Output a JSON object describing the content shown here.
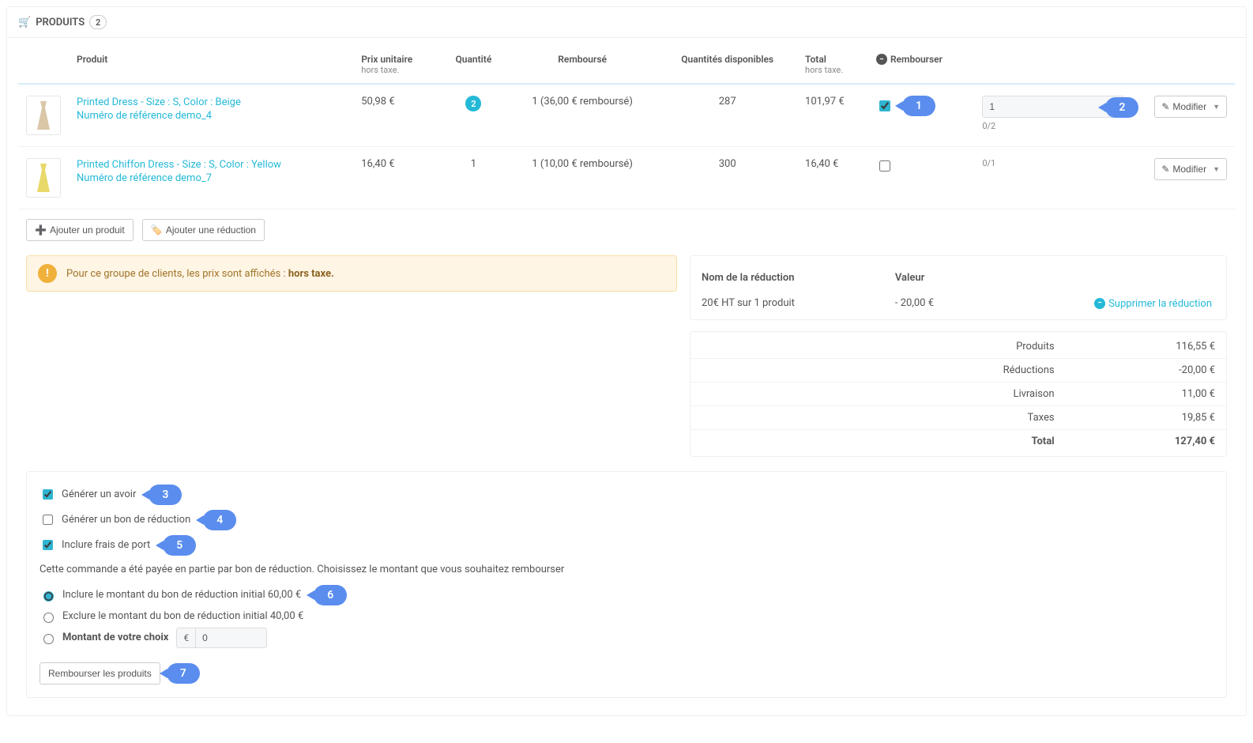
{
  "header": {
    "title": "PRODUITS",
    "count": "2"
  },
  "columns": {
    "product": "Produit",
    "unit_price": "Prix unitaire",
    "tax_note": "hors taxe.",
    "quantity": "Quantité",
    "refunded": "Remboursé",
    "avail_qty": "Quantités disponibles",
    "total": "Total",
    "refund": "Rembourser"
  },
  "products": [
    {
      "name": "Printed Dress - Size : S, Color : Beige",
      "ref": "Numéro de référence demo_4",
      "unit_price": "50,98 €",
      "quantity": "2",
      "qty_badge": true,
      "refunded": "1 (36,00 € remboursé)",
      "available": "287",
      "total": "101,97 €",
      "checkbox_checked": true,
      "callout_check": "1",
      "qty_input_value": "1",
      "callout_qty": "2",
      "qty_limit": "0/2",
      "edit_label": "Modifier"
    },
    {
      "name": "Printed Chiffon Dress - Size : S, Color : Yellow",
      "ref": "Numéro de référence demo_7",
      "unit_price": "16,40 €",
      "quantity": "1",
      "qty_badge": false,
      "refunded": "1 (10,00 € remboursé)",
      "available": "300",
      "total": "16,40 €",
      "checkbox_checked": false,
      "qty_limit": "0/1",
      "edit_label": "Modifier"
    }
  ],
  "actions": {
    "add_product": "Ajouter un produit",
    "add_discount": "Ajouter une réduction"
  },
  "notice": {
    "text_prefix": "Pour ce groupe de clients, les prix sont affichés : ",
    "text_bold": "hors taxe."
  },
  "discount_table": {
    "name_header": "Nom de la réduction",
    "value_header": "Valeur",
    "row_name": "20€ HT sur 1 produit",
    "row_value": "- 20,00 €",
    "delete": "Supprimer la réduction"
  },
  "totals": {
    "products_label": "Produits",
    "products_value": "116,55 €",
    "discounts_label": "Réductions",
    "discounts_value": "-20,00 €",
    "shipping_label": "Livraison",
    "shipping_value": "11,00 €",
    "taxes_label": "Taxes",
    "taxes_value": "19,85 €",
    "total_label": "Total",
    "total_value": "127,40 €"
  },
  "refund_opts": {
    "credit_slip": "Générer un avoir",
    "voucher": "Générer un bon de réduction",
    "shipping": "Inclure frais de port",
    "info": "Cette commande a été payée en partie par bon de réduction. Choisissez le montant que vous souhaitez rembourser",
    "include": "Inclure le montant du bon de réduction initial 60,00 €",
    "exclude": "Exclure le montant du bon de réduction initial 40,00 €",
    "custom": "Montant de votre choix",
    "currency": "€",
    "custom_value": "0",
    "submit": "Rembourser les produits",
    "callouts": {
      "c3": "3",
      "c4": "4",
      "c5": "5",
      "c6": "6",
      "c7": "7"
    }
  }
}
